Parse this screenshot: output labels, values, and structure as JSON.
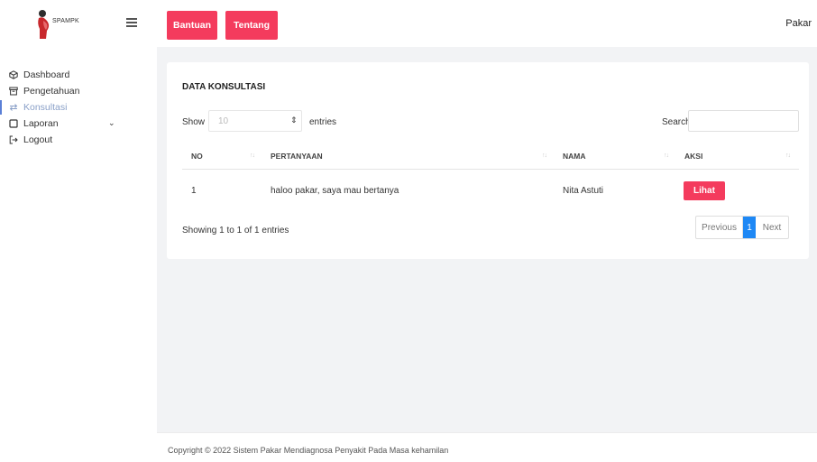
{
  "brand": {
    "name": "SPAMPK"
  },
  "sidebar": {
    "items": [
      {
        "label": "Dashboard",
        "icon": "box-icon"
      },
      {
        "label": "Pengetahuan",
        "icon": "archive-icon"
      },
      {
        "label": "Konsultasi",
        "icon": "transfer-icon",
        "active": true
      },
      {
        "label": "Laporan",
        "icon": "square-icon",
        "has_submenu": true
      },
      {
        "label": "Logout",
        "icon": "logout-icon"
      }
    ]
  },
  "topbar": {
    "buttons": [
      "Bantuan",
      "Tentang"
    ],
    "user": "Pakar"
  },
  "card": {
    "title": "DATA KONSULTASI",
    "show_label": "Show",
    "entries_value": "10",
    "entries_label": "entries",
    "search_label": "Search:",
    "search_value": "",
    "columns": [
      "NO",
      "PERTANYAAN",
      "NAMA",
      "AKSI"
    ],
    "rows": [
      {
        "no": "1",
        "pertanyaan": "haloo pakar, saya mau bertanya",
        "nama": "Nita Astuti",
        "aksi": "Lihat"
      }
    ],
    "info": "Showing 1 to 1 of 1 entries",
    "pagination": {
      "previous": "Previous",
      "current": "1",
      "next": "Next"
    }
  },
  "footer": {
    "text": "Copyright © 2022 Sistem Pakar Mendiagnosa Penyakit Pada Masa kehamilan"
  },
  "colors": {
    "accent": "#f43b5d",
    "page_active": "#1e88f5",
    "sidebar_active": "#8aa0c8"
  }
}
